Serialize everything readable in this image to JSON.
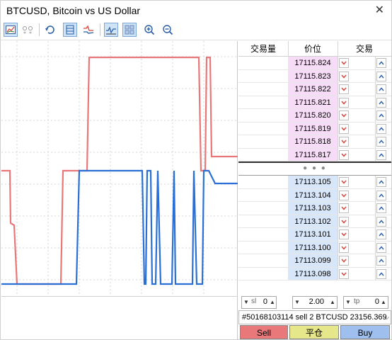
{
  "window": {
    "title": "BTCUSD, Bitcoin vs US Dollar"
  },
  "toolbar": {
    "icons": [
      "chart-icon",
      "link-icon",
      "refresh-icon",
      "level-lines-icon",
      "tick-chart-icon",
      "volume-chart-icon",
      "indicators-icon",
      "zoom-in-icon",
      "zoom-out-icon"
    ]
  },
  "dom": {
    "headers": {
      "volume": "交易量",
      "price": "价位",
      "trade": "交易"
    },
    "asks": [
      "17115.824",
      "17115.823",
      "17115.822",
      "17115.821",
      "17115.820",
      "17115.819",
      "17115.818",
      "17115.817"
    ],
    "bids": [
      "17113.105",
      "17113.104",
      "17113.103",
      "17113.102",
      "17113.101",
      "17113.100",
      "17113.099",
      "17113.098"
    ],
    "divider": "● ● ●"
  },
  "controls": {
    "sl_label": "sl",
    "sl_value": "0",
    "volume_value": "2.00",
    "tp_label": "tp",
    "tp_value": "0"
  },
  "order": {
    "text": "#50168103114 sell 2 BTCUSD 23156.369"
  },
  "actions": {
    "sell": "Sell",
    "close": "平仓",
    "buy": "Buy"
  },
  "colors": {
    "ask_line": "#e8777a",
    "bid_line": "#2a6fd6",
    "ask_bg": "#f7dcf7",
    "bid_bg": "#d8e6fa"
  }
}
